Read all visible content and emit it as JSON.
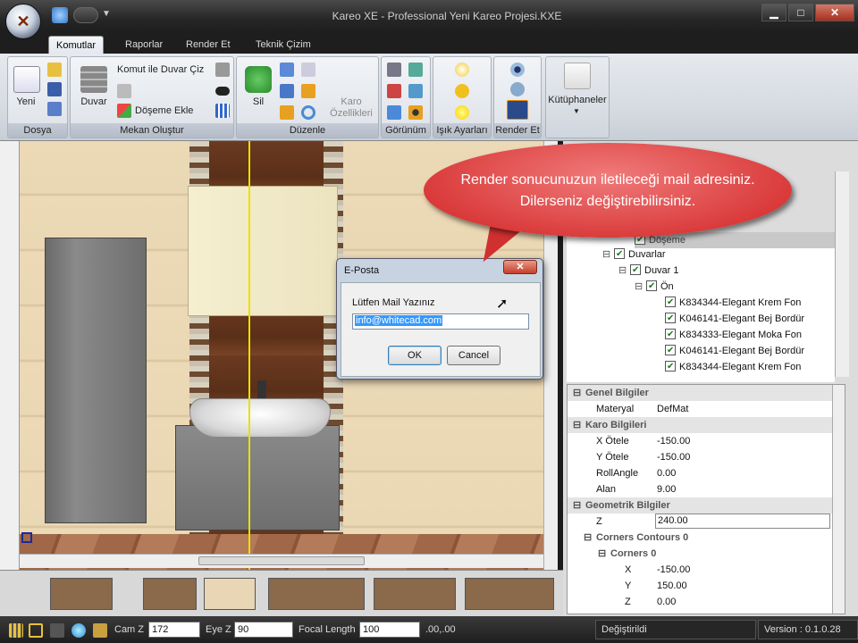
{
  "window": {
    "title": "Kareo XE - Professional Yeni Kareo Projesi.KXE"
  },
  "controls": {
    "minimize": "▁",
    "maximize": "□",
    "close": "✕"
  },
  "tabs": [
    {
      "label": "Komutlar"
    },
    {
      "label": "Raporlar"
    },
    {
      "label": "Render Et"
    },
    {
      "label": "Teknik Çizim"
    }
  ],
  "ribbon": {
    "dosya": {
      "group": "Dosya",
      "yeni": "Yeni"
    },
    "mekan": {
      "group": "Mekan Oluştur",
      "duvar": "Duvar",
      "komut_duvar": "Komut ile Duvar Çiz",
      "doseme_ekle": "Döşeme Ekle"
    },
    "duzenle": {
      "group": "Düzenle",
      "sil": "Sil",
      "karo_ozellikleri": "Karo Özellikleri"
    },
    "gorunum": {
      "group": "Görünüm"
    },
    "isik": {
      "group": "Işık Ayarları"
    },
    "render": {
      "group": "Render Et"
    },
    "kutuphaneler": {
      "label": "Kütüphaneler"
    }
  },
  "callout": {
    "text": "Render sonucunuzun iletileceği mail adresiniz. Dilerseniz değiştirebilirsiniz."
  },
  "dialog": {
    "title": "E-Posta",
    "label": "Lütfen Mail Yazınız",
    "value": "info@whitecad.com",
    "ok": "OK",
    "cancel": "Cancel"
  },
  "tree": {
    "doseme": "Döşeme",
    "duvarlar": "Duvarlar",
    "duvar1": "Duvar 1",
    "on": "Ön",
    "items": [
      "K834344-Elegant Krem Fon",
      "K046141-Elegant Bej Bordür",
      "K834333-Elegant Moka Fon",
      "K046141-Elegant Bej Bordür",
      "K834344-Elegant Krem Fon"
    ]
  },
  "properties": {
    "genel": "Genel Bilgiler",
    "materyal_k": "Materyal",
    "materyal_v": "DefMat",
    "karo": "Karo Bilgileri",
    "xotele_k": "X Ötele",
    "xotele_v": "-150.00",
    "yotele_k": "Y Ötele",
    "yotele_v": "-150.00",
    "roll_k": "RollAngle",
    "roll_v": "0.00",
    "alan_k": "Alan",
    "alan_v": "9.00",
    "geo": "Geometrik Bilgiler",
    "z_k": "Z",
    "z_v": "240.00",
    "contours": "Corners Contours 0",
    "corners": "Corners 0",
    "cx_k": "X",
    "cx_v": "-150.00",
    "cy_k": "Y",
    "cy_v": "150.00",
    "cz_k": "Z",
    "cz_v": "0.00"
  },
  "statusbar": {
    "camz_label": "Cam Z",
    "camz_value": "172",
    "eyez_label": "Eye Z",
    "eyez_value": "90",
    "focal_label": "Focal Length",
    "focal_value": "100",
    "coords": ".00,.00",
    "state": "Değiştirildi",
    "version": "Version : 0.1.0.28"
  },
  "colors": {
    "callout": "#d93838",
    "accent": "#3399ff"
  }
}
